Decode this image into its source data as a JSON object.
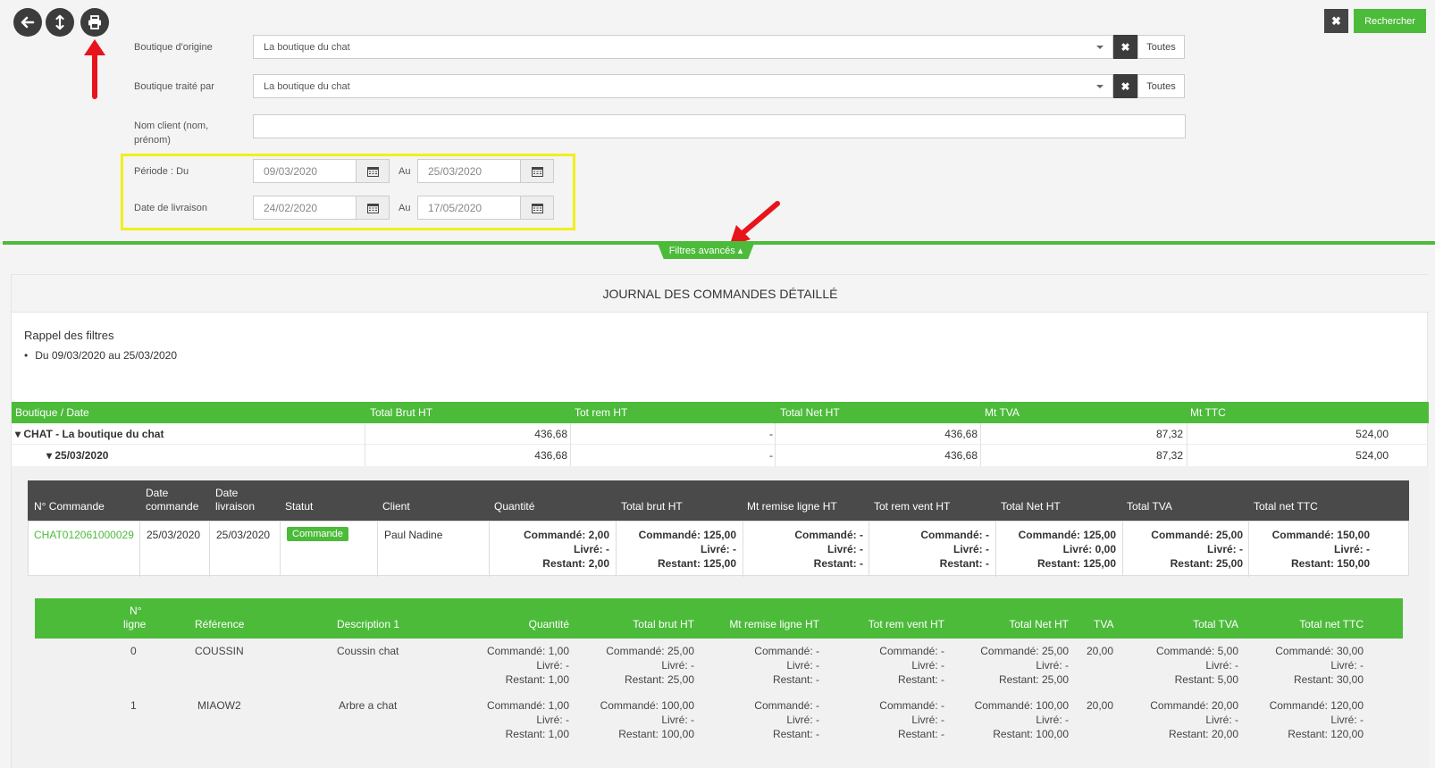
{
  "filters": {
    "boutique_origine": {
      "label": "Boutique d'origine",
      "value": "La boutique du chat",
      "all": "Toutes"
    },
    "boutique_traite": {
      "label": "Boutique traité par",
      "value": "La boutique du chat",
      "all": "Toutes"
    },
    "nom_client": {
      "label_line1": "Nom client (nom,",
      "label_line2": "prénom)",
      "value": ""
    },
    "periode": {
      "label": "Période : Du",
      "from": "09/03/2020",
      "to_label": "Au",
      "to": "25/03/2020"
    },
    "livraison": {
      "label": "Date de livraison",
      "from": "24/02/2020",
      "to_label": "Au",
      "to": "17/05/2020"
    },
    "search_label": "Rechercher",
    "clear_label": "✖",
    "advanced_label": "Filtres avancés ▴"
  },
  "toolbar": {
    "icons": [
      "arrow-left-icon",
      "arrows-vertical-icon",
      "print-icon"
    ]
  },
  "report": {
    "title": "JOURNAL DES COMMANDES DÉTAILLÉ",
    "rappel_title": "Rappel des filtres",
    "rappel_item": "Du 09/03/2020 au 25/03/2020",
    "summary_headers": [
      "Boutique / Date",
      "Total Brut HT",
      "Tot rem HT",
      "Total Net HT",
      "Mt TVA",
      "Mt TTC"
    ],
    "summary_rows": [
      {
        "label": "CHAT - La boutique du chat",
        "values": [
          "436,68",
          "-",
          "436,68",
          "87,32",
          "524,00"
        ]
      },
      {
        "label": "25/03/2020",
        "values": [
          "436,68",
          "-",
          "436,68",
          "87,32",
          "524,00"
        ]
      }
    ],
    "order_headers": {
      "num": "N° Commande",
      "date_cmd_1": "Date",
      "date_cmd_2": "commande",
      "date_liv_1": "Date",
      "date_liv_2": "livraison",
      "statut": "Statut",
      "client": "Client",
      "qte": "Quantité",
      "brut": "Total brut HT",
      "remise": "Mt remise ligne HT",
      "remvent": "Tot rem vent HT",
      "net": "Total Net HT",
      "tva": "Total TVA",
      "ttc": "Total net TTC"
    },
    "order": {
      "num": "CHAT012061000029",
      "date_cmd": "25/03/2020",
      "date_liv": "25/03/2020",
      "statut": "Commande",
      "client": "Paul Nadine",
      "cols": [
        [
          "Commandé: 2,00",
          "Livré: -",
          "Restant: 2,00"
        ],
        [
          "Commandé: 125,00",
          "Livré: -",
          "Restant: 125,00"
        ],
        [
          "Commandé: -",
          "Livré: -",
          "Restant: -"
        ],
        [
          "Commandé: -",
          "Livré: -",
          "Restant: -"
        ],
        [
          "Commandé: 125,00",
          "Livré: 0,00",
          "Restant: 125,00"
        ],
        [
          "Commandé: 25,00",
          "Livré: -",
          "Restant: 25,00"
        ],
        [
          "Commandé: 150,00",
          "Livré: -",
          "Restant: 150,00"
        ]
      ]
    },
    "line_headers": {
      "num_1": "N°",
      "num_2": "ligne",
      "ref": "Référence",
      "desc": "Description 1",
      "qte": "Quantité",
      "brut": "Total brut HT",
      "remise": "Mt remise ligne HT",
      "remvent": "Tot rem vent HT",
      "net": "Total Net HT",
      "tva": "TVA",
      "ttva": "Total TVA",
      "ttc": "Total net TTC"
    },
    "lines": [
      {
        "num": "0",
        "ref": "COUSSIN",
        "desc": "Coussin chat",
        "tva": "20,00",
        "cols": [
          [
            "Commandé: 1,00",
            "Livré: -",
            "Restant: 1,00"
          ],
          [
            "Commandé: 25,00",
            "Livré: -",
            "Restant: 25,00"
          ],
          [
            "Commandé: -",
            "Livré: -",
            "Restant: -"
          ],
          [
            "Commandé: -",
            "Livré: -",
            "Restant: -"
          ],
          [
            "Commandé: 25,00",
            "Livré: -",
            "Restant: 25,00"
          ],
          [
            "Commandé: 5,00",
            "Livré: -",
            "Restant: 5,00"
          ],
          [
            "Commandé: 30,00",
            "Livré: -",
            "Restant: 30,00"
          ]
        ]
      },
      {
        "num": "1",
        "ref": "MIAOW2",
        "desc": "Arbre a chat",
        "tva": "20,00",
        "cols": [
          [
            "Commandé: 1,00",
            "Livré: -",
            "Restant: 1,00"
          ],
          [
            "Commandé: 100,00",
            "Livré: -",
            "Restant: 100,00"
          ],
          [
            "Commandé: -",
            "Livré: -",
            "Restant: -"
          ],
          [
            "Commandé: -",
            "Livré: -",
            "Restant: -"
          ],
          [
            "Commandé: 100,00",
            "Livré: -",
            "Restant: 100,00"
          ],
          [
            "Commandé: 20,00",
            "Livré: -",
            "Restant: 20,00"
          ],
          [
            "Commandé: 120,00",
            "Livré: -",
            "Restant: 120,00"
          ]
        ]
      }
    ]
  },
  "colors": {
    "green": "#4cbb3a",
    "dark": "#3c3c3c",
    "highlight": "#f2ee1b",
    "arrow": "#e8141b"
  }
}
